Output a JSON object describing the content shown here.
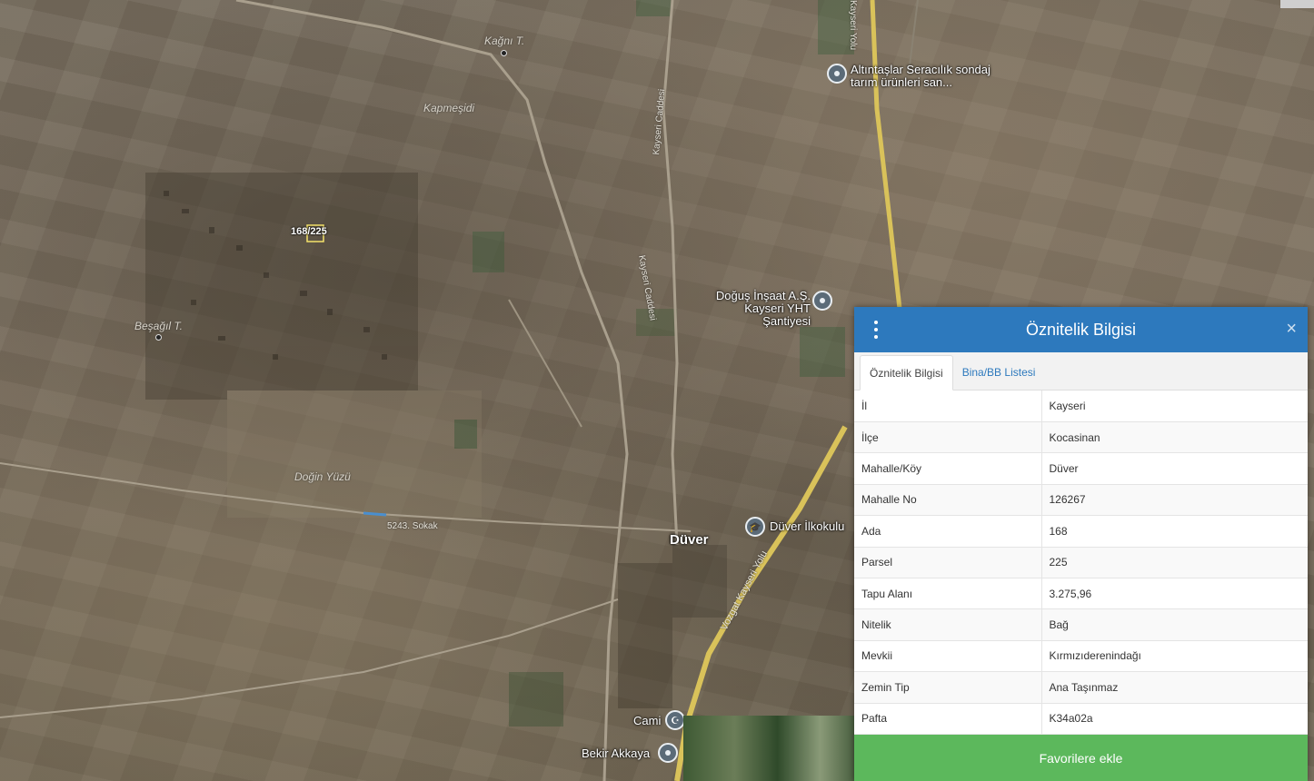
{
  "map": {
    "labels": {
      "kagni": "Kağnı T.",
      "kapmesidi": "Kapmeşidi",
      "besagil": "Beşağıl T.",
      "dogin_yuzu": "Doğin Yüzü",
      "duver": "Düver",
      "kayseri_yolu_top": "Kayseri Yolu",
      "kayseri_caddesi": "Kayseri Caddesi",
      "kayseri_caddesi_2": "Kayseri Caddesi",
      "vozgat_kayseri_yolu": "Vozgat Kayseri Yolu",
      "road_5243": "5243. Sokak"
    },
    "pois": {
      "altintaslar": "Altıntaşlar Seracılık sondaj tarım ürünleri san...",
      "dogus": "Doğuş İnşaat A.Ş. Kayseri YHT Şantiyesi",
      "duver_ilkokulu": "Düver İlkokulu",
      "cami": "Cami",
      "bekir_akkaya": "Bekir Akkaya"
    },
    "parcel_label": "168/225"
  },
  "panel": {
    "title": "Öznitelik Bilgisi",
    "close_glyph": "×",
    "tabs": [
      {
        "label": "Öznitelik Bilgisi"
      },
      {
        "label": "Bina/BB Listesi"
      }
    ],
    "rows": [
      {
        "key": "İl",
        "value": "Kayseri"
      },
      {
        "key": "İlçe",
        "value": "Kocasinan"
      },
      {
        "key": "Mahalle/Köy",
        "value": "Düver"
      },
      {
        "key": "Mahalle No",
        "value": "126267"
      },
      {
        "key": "Ada",
        "value": "168"
      },
      {
        "key": "Parsel",
        "value": "225"
      },
      {
        "key": "Tapu Alanı",
        "value": "3.275,96"
      },
      {
        "key": "Nitelik",
        "value": "Bağ"
      },
      {
        "key": "Mevkii",
        "value": "Kırmızıderenindağı"
      },
      {
        "key": "Zemin Tip",
        "value": "Ana Taşınmaz"
      },
      {
        "key": "Pafta",
        "value": "K34a02a"
      }
    ],
    "favorite_button": "Favorilere ekle"
  },
  "colors": {
    "header_blue": "#2d79bd",
    "favorite_green": "#5cb85c",
    "road_yellow": "#d9c25a"
  }
}
